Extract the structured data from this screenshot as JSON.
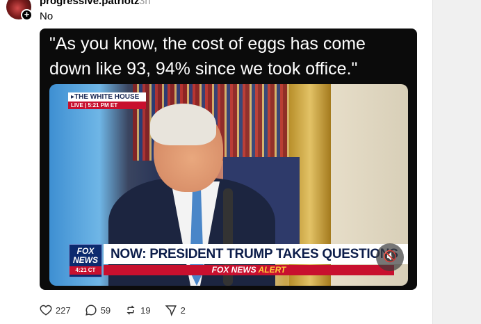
{
  "post": {
    "username": "progressive.patriotz",
    "time": "3h",
    "text": "No",
    "quote": "\"As you know, the cost of eggs has come down like 93, 94% since we took office.\"",
    "video": {
      "badge_title": "▸THE WHITE HOUSE",
      "badge_live": "LIVE  |  5:21 PM ET",
      "logo_line1": "FOX",
      "logo_line2": "NEWS",
      "logo_time": "4:21 CT",
      "headline": "NOW: PRESIDENT TRUMP TAKES QUESTIONS",
      "alert_brand": "FOX NEWS",
      "alert_word": "ALERT",
      "muted": true
    },
    "actions": {
      "likes": "227",
      "replies": "59",
      "reposts": "19",
      "shares": "2"
    }
  }
}
